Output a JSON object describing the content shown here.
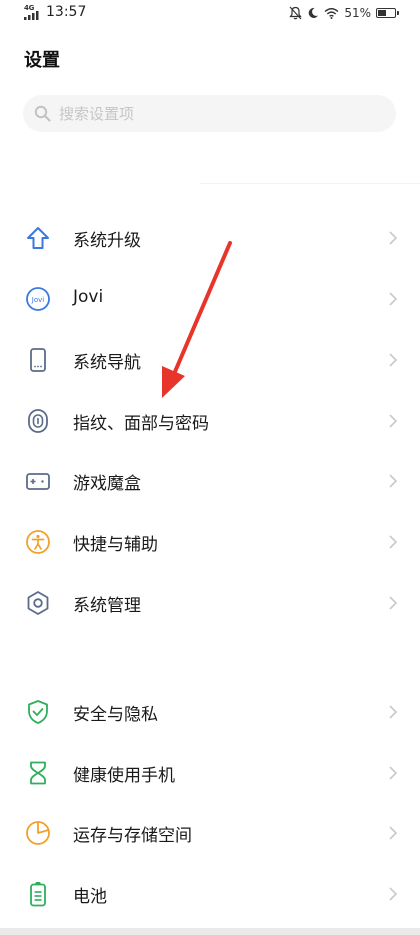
{
  "status_bar": {
    "network": "4G",
    "time": "13:57",
    "battery_pct_text": "51%",
    "battery_level": 0.51
  },
  "header": {
    "title": "设置"
  },
  "search": {
    "placeholder": "搜索设置项"
  },
  "settings": {
    "group1": [
      {
        "label": "系统升级",
        "icon": "arrow-up-icon",
        "color": "#3a78e0"
      },
      {
        "label": "Jovi",
        "icon": "jovi-icon",
        "color": "#3a78e0"
      },
      {
        "label": "系统导航",
        "icon": "phone-nav-icon",
        "color": "#5b6b8a"
      },
      {
        "label": "指纹、面部与密码",
        "icon": "fingerprint-icon",
        "color": "#5b6b8a"
      },
      {
        "label": "游戏魔盒",
        "icon": "game-box-icon",
        "color": "#5b6b8a"
      },
      {
        "label": "快捷与辅助",
        "icon": "accessibility-icon",
        "color": "#f2a028"
      },
      {
        "label": "系统管理",
        "icon": "system-gear-icon",
        "color": "#5b6b8a"
      }
    ],
    "group2": [
      {
        "label": "安全与隐私",
        "icon": "shield-check-icon",
        "color": "#2fae5b"
      },
      {
        "label": "健康使用手机",
        "icon": "hourglass-icon",
        "color": "#2fae5b"
      },
      {
        "label": "运存与存储空间",
        "icon": "pie-chart-icon",
        "color": "#f2a028"
      },
      {
        "label": "电池",
        "icon": "battery-icon",
        "color": "#2fae5b"
      }
    ]
  },
  "annotation": {
    "color": "#e8352b"
  }
}
